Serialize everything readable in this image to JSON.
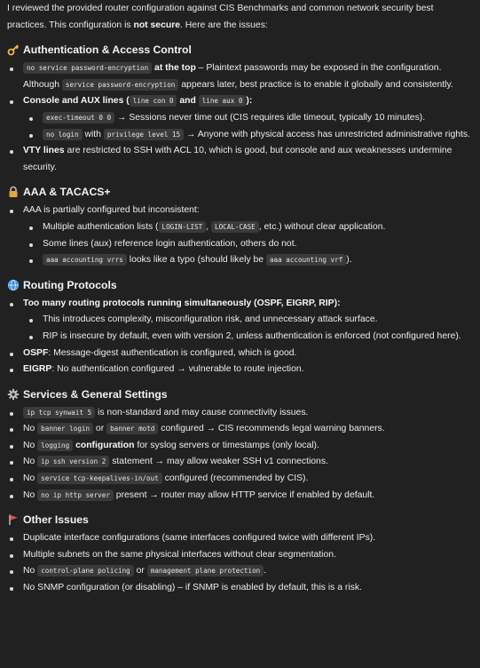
{
  "intro": {
    "p1": "I reviewed the provided router configuration against CIS Benchmarks and common network security best practices. This configuration is ",
    "not_secure": "not secure",
    "p2": ". Here are the issues:"
  },
  "sections": {
    "auth": {
      "icon": "key-icon",
      "title": "Authentication & Access Control",
      "i1": {
        "c1": "no service password-encryption",
        "b1": " at the top",
        "t1": " – Plaintext passwords may be exposed in the configuration. Although ",
        "c2": "service password-encryption",
        "t2": " appears later, best practice is to enable it globally and consistently."
      },
      "i2": {
        "b1": "Console and AUX lines",
        "t1": " (",
        "c1": "line con 0",
        "t2": " and ",
        "c2": "line aux 0",
        "t3": "):",
        "s1": {
          "c1": "exec-timeout 0 0",
          "t1": " → Sessions never time out (CIS requires idle timeout, typically 10 minutes)."
        },
        "s2": {
          "c1": "no login",
          "t1": " with ",
          "c2": "privilege level 15",
          "t2": " → Anyone with physical access has unrestricted administrative rights."
        }
      },
      "i3": {
        "b1": "VTY lines",
        "t1": " are restricted to SSH with ACL 10, which is good, but console and aux weaknesses undermine security."
      }
    },
    "aaa": {
      "icon": "lock-icon",
      "title": "AAA & TACACS+",
      "i1": {
        "t1": "AAA is partially configured but inconsistent:",
        "s1": {
          "t1": "Multiple authentication lists (",
          "c1": "LOGIN-LIST",
          "t2": ", ",
          "c2": "LOCAL-CASE",
          "t3": ", etc.) without clear application."
        },
        "s2": {
          "t1": "Some lines (aux) reference login authentication, others do not."
        },
        "s3": {
          "c1": "aaa accounting vrrs",
          "t1": " looks like a typo (should likely be ",
          "c2": "aaa accounting vrf",
          "t2": ")."
        }
      }
    },
    "routing": {
      "icon": "globe-icon",
      "title": "Routing Protocols",
      "i1": {
        "b1": "Too many routing protocols running simultaneously (OSPF, EIGRP, RIP):",
        "s1": {
          "t1": "This introduces complexity, misconfiguration risk, and unnecessary attack surface."
        },
        "s2": {
          "t1": "RIP is insecure by default, even with version 2, unless authentication is enforced (not configured here)."
        }
      },
      "i2": {
        "b1": "OSPF",
        "t1": ": Message-digest authentication is configured, which is good."
      },
      "i3": {
        "b1": "EIGRP",
        "t1": ": No authentication configured → vulnerable to route injection."
      }
    },
    "services": {
      "icon": "gear-icon",
      "title": "Services & General Settings",
      "i1": {
        "c1": "ip tcp synwait 5",
        "t1": " is non-standard and may cause connectivity issues."
      },
      "i2": {
        "t1": "No ",
        "c1": "banner login",
        "t2": " or ",
        "c2": "banner motd",
        "t3": " configured → CIS recommends legal warning banners."
      },
      "i3": {
        "t1": "No ",
        "c1": "logging",
        "b1": " configuration",
        "t2": " for syslog servers or timestamps (only local)."
      },
      "i4": {
        "t1": "No ",
        "c1": "ip ssh version 2",
        "t2": " statement → may allow weaker SSH v1 connections."
      },
      "i5": {
        "t1": "No ",
        "c1": "service tcp-keepalives-in/out",
        "t2": " configured (recommended by CIS)."
      },
      "i6": {
        "t1": "No ",
        "c1": "no ip http server",
        "t2": " present → router may allow HTTP service if enabled by default."
      }
    },
    "other": {
      "icon": "flag-icon",
      "title": "Other Issues",
      "i1": {
        "t1": "Duplicate interface configurations (same interfaces configured twice with different IPs)."
      },
      "i2": {
        "t1": "Multiple subnets on the same physical interfaces without clear segmentation."
      },
      "i3": {
        "t1": "No ",
        "c1": "control-plane policing",
        "t2": " or ",
        "c2": "management plane protection",
        "t3": "."
      },
      "i4": {
        "t1": "No SNMP configuration (or disabling) – if SNMP is enabled by default, this is a risk."
      }
    }
  }
}
